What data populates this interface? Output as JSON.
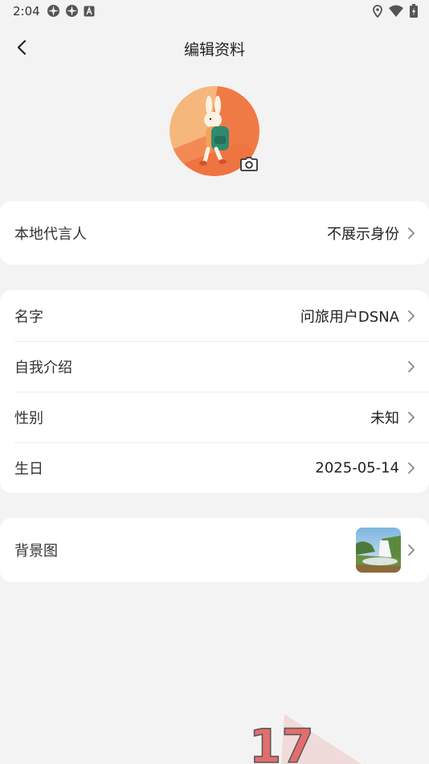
{
  "status_bar": {
    "time": "2:04"
  },
  "header": {
    "title": "编辑资料"
  },
  "rows": {
    "local_rep": {
      "label": "本地代言人",
      "value": "不展示身份"
    },
    "name": {
      "label": "名字",
      "value": "问旅用户DSNA"
    },
    "intro": {
      "label": "自我介绍",
      "value": ""
    },
    "gender": {
      "label": "性别",
      "value": "未知"
    },
    "birthday": {
      "label": "生日",
      "value": "2025-05-14"
    },
    "background": {
      "label": "背景图"
    }
  },
  "watermark": {
    "text": "17"
  },
  "icons": [
    "back-arrow-icon",
    "camera-icon",
    "chevron-right-icon",
    "location-icon",
    "wifi-icon",
    "battery-icon"
  ],
  "colors": {
    "background": "#f3f3f3",
    "card": "#ffffff",
    "avatar_accent": "#f07a45"
  }
}
